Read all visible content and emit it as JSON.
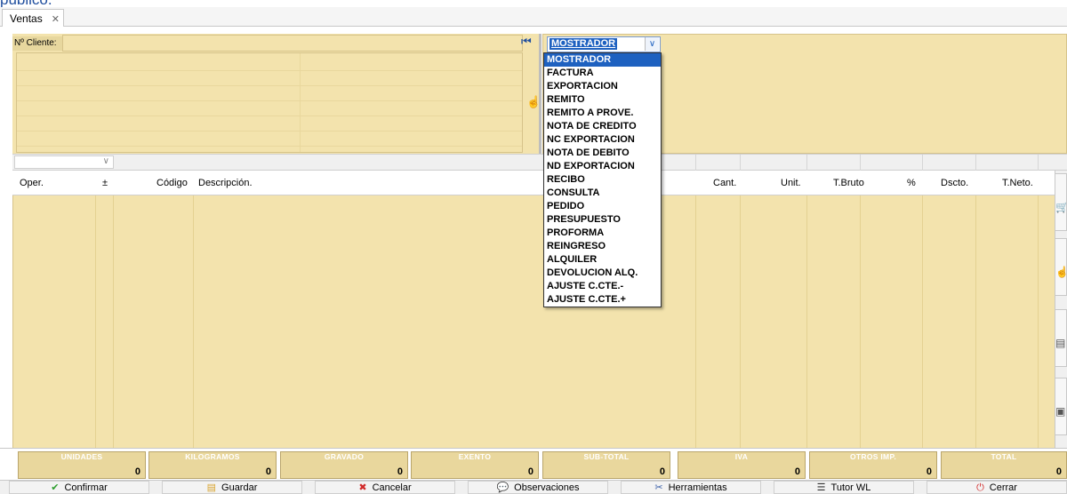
{
  "top_cut_text": "publico.",
  "tab": {
    "label": "Ventas",
    "close": "✕"
  },
  "cliente": {
    "label": "Nº Cliente:",
    "value": ""
  },
  "comprobante": {
    "selected": "MOSTRADOR",
    "options": [
      "MOSTRADOR",
      "FACTURA",
      "EXPORTACION",
      "REMITO",
      "REMITO A PROVE.",
      "NOTA DE CREDITO",
      "NC EXPORTACION",
      "NOTA DE DEBITO",
      "ND EXPORTACION",
      "RECIBO",
      "CONSULTA",
      "PEDIDO",
      "PRESUPUESTO",
      "PROFORMA",
      "REINGRESO",
      "ALQUILER",
      "DEVOLUCION ALQ.",
      "AJUSTE C.CTE.-",
      "AJUSTE C.CTE.+"
    ]
  },
  "grid_headers": {
    "oper": "Oper.",
    "pm": "±",
    "codigo": "Código",
    "descripcion": "Descripción.",
    "cant": "Cant.",
    "unit": "Unit.",
    "tbruto": "T.Bruto",
    "pct": "%",
    "dscto": "Dscto.",
    "tneto": "T.Neto."
  },
  "totals": [
    {
      "label": "UNIDADES",
      "value": "0"
    },
    {
      "label": "KILOGRAMOS",
      "value": "0"
    },
    {
      "label": "GRAVADO",
      "value": "0"
    },
    {
      "label": "EXENTO",
      "value": "0"
    },
    {
      "label": "SUB-TOTAL",
      "value": "0"
    },
    {
      "label": "IVA",
      "value": "0"
    },
    {
      "label": "OTROS IMP.",
      "value": "0"
    },
    {
      "label": "TOTAL",
      "value": "0"
    }
  ],
  "footer_buttons": [
    {
      "label": "Confirmar",
      "icon": "check-circle-icon",
      "color": "#2e9e2e"
    },
    {
      "label": "Guardar",
      "icon": "save-icon",
      "color": "#d9a531"
    },
    {
      "label": "Cancelar",
      "icon": "cancel-icon",
      "color": "#d12a2a"
    },
    {
      "label": "Observaciones",
      "icon": "comments-icon",
      "color": "#3a7bd5"
    },
    {
      "label": "Herramientas",
      "icon": "tools-icon",
      "color": "#3a5fa8"
    },
    {
      "label": "Tutor WL",
      "icon": "tutor-icon",
      "color": "#333333"
    },
    {
      "label": "Cerrar",
      "icon": "power-icon",
      "color": "#d12a2a"
    }
  ]
}
